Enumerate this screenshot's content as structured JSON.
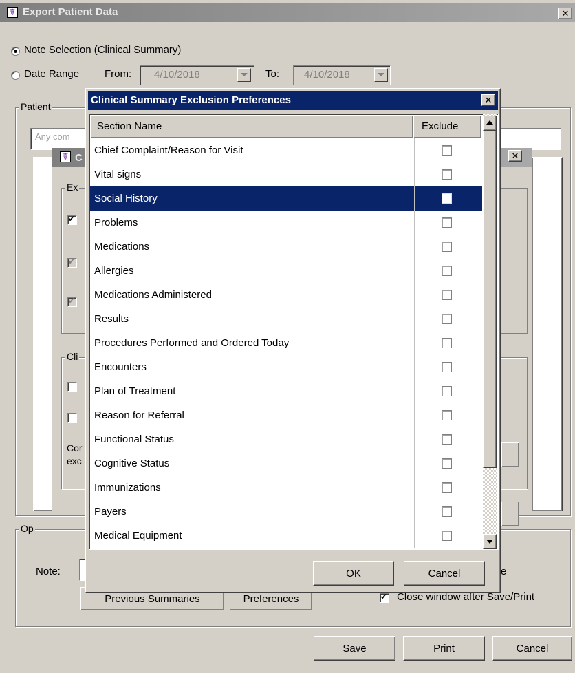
{
  "export_window": {
    "title": "Export Patient Data",
    "radio_note_selection": "Note Selection (Clinical Summary)",
    "radio_date_range": "Date Range",
    "from_label": "From:",
    "from_value": "4/10/2018",
    "to_label": "To:",
    "to_value": "4/10/2018",
    "patient_group": "Patient",
    "patient_search_placeholder": "Any com",
    "options_group": "Op",
    "note_label": "Note:",
    "previous_summaries": "Previous Summaries",
    "preferences": "Preferences",
    "close_after_save_partial": "e",
    "close_after_save": "Close window after Save/Print",
    "close_after_save_checked": true,
    "save": "Save",
    "print": "Print",
    "cancel": "Cancel"
  },
  "mid_dialog": {
    "title_partial": "C",
    "group1_partial": "Ex",
    "group2_partial": "Cli",
    "text_line1": "Cor",
    "text_line2": "exc"
  },
  "exclusion_dialog": {
    "title": "Clinical Summary Exclusion Preferences",
    "col_section_name": "Section Name",
    "col_exclude": "Exclude",
    "selected_index": 2,
    "sections": [
      {
        "name": "Chief Complaint/Reason for Visit",
        "exclude": false
      },
      {
        "name": "Vital signs",
        "exclude": false
      },
      {
        "name": "Social History",
        "exclude": false
      },
      {
        "name": "Problems",
        "exclude": false
      },
      {
        "name": "Medications",
        "exclude": false
      },
      {
        "name": "Allergies",
        "exclude": false
      },
      {
        "name": "Medications Administered",
        "exclude": false
      },
      {
        "name": "Results",
        "exclude": false
      },
      {
        "name": "Procedures Performed and Ordered Today",
        "exclude": false
      },
      {
        "name": "Encounters",
        "exclude": false
      },
      {
        "name": "Plan of Treatment",
        "exclude": false
      },
      {
        "name": "Reason for Referral",
        "exclude": false
      },
      {
        "name": "Functional Status",
        "exclude": false
      },
      {
        "name": "Cognitive Status",
        "exclude": false
      },
      {
        "name": "Immunizations",
        "exclude": false
      },
      {
        "name": "Payers",
        "exclude": false
      },
      {
        "name": "Medical Equipment",
        "exclude": false
      }
    ],
    "ok": "OK",
    "cancel": "Cancel"
  },
  "icons": {
    "app": "caduceus-icon",
    "close": "close-icon",
    "dropdown": "chevron-down-icon",
    "scroll_up": "arrow-up-icon",
    "scroll_down": "arrow-down-icon"
  }
}
